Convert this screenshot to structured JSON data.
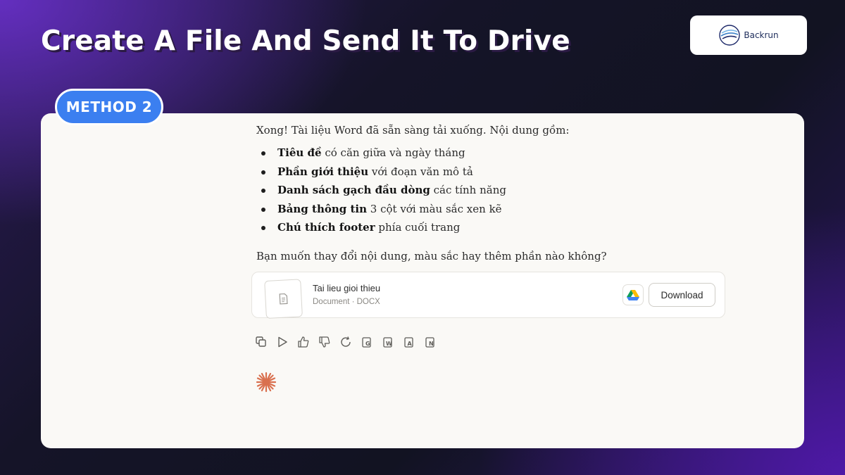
{
  "header": {
    "title": "Create A File And Send It To Drive"
  },
  "brand": {
    "name": "Backrun",
    "logo_icon": "backrun-logo-icon"
  },
  "method_badge": {
    "label": "METHOD 2",
    "color": "#3b7ff0"
  },
  "chat": {
    "intro": "Xong! Tài liệu Word đã sẵn sàng tải xuống. Nội dung gồm:",
    "bullets": [
      {
        "bold": "Tiêu đề",
        "text": " có căn giữa và ngày tháng"
      },
      {
        "bold": "Phần giới thiệu",
        "text": " với đoạn văn mô tả"
      },
      {
        "bold": "Danh sách gạch đầu dòng",
        "text": " các tính năng"
      },
      {
        "bold": "Bảng thông tin",
        "text": " 3 cột với màu sắc xen kẽ"
      },
      {
        "bold": "Chú thích footer",
        "text": " phía cuối trang"
      }
    ],
    "question": "Bạn muốn thay đổi nội dung, màu sắc hay thêm phần nào không?"
  },
  "file": {
    "name": "Tai lieu gioi thieu",
    "meta": "Document · DOCX",
    "drive_icon": "google-drive-icon",
    "download_label": "Download"
  },
  "actions": [
    {
      "name": "copy-icon",
      "label": "Copy"
    },
    {
      "name": "play-icon",
      "label": "Read aloud"
    },
    {
      "name": "thumbs-up-icon",
      "label": "Good response"
    },
    {
      "name": "thumbs-down-icon",
      "label": "Bad response"
    },
    {
      "name": "retry-icon",
      "label": "Retry"
    },
    {
      "name": "export-gdocs-icon",
      "label": "G"
    },
    {
      "name": "export-word-icon",
      "label": "W"
    },
    {
      "name": "export-pdf-icon",
      "label": "A"
    },
    {
      "name": "export-notion-icon",
      "label": "N"
    }
  ],
  "colors": {
    "accent": "#3b7ff0",
    "spark": "#d9704f",
    "panel": "#faf9f6"
  }
}
